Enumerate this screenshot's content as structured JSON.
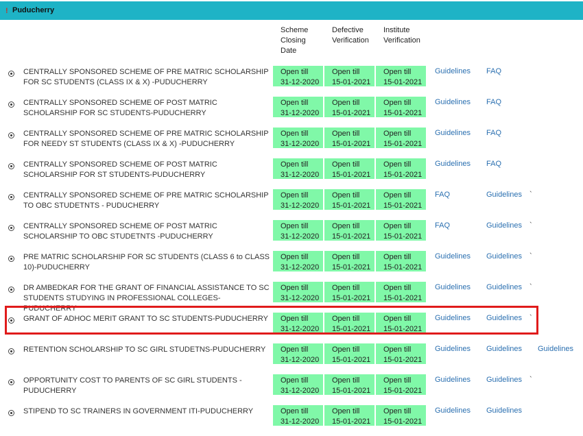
{
  "header": {
    "mark": "!",
    "title": "Puducherry"
  },
  "columns": {
    "closing": "Scheme Closing Date",
    "defective": "Defective Verification",
    "institute": "Institute Verification"
  },
  "rows": [
    {
      "name": "CENTRALLY SPONSORED SCHEME OF PRE MATRIC SCHOLARSHIP FOR SC STUDENTS (CLASS IX & X) -PUDUCHERRY",
      "closing": [
        "Open till",
        "31-12-2020"
      ],
      "defective": [
        "Open till",
        "15-01-2021"
      ],
      "institute": [
        "Open till",
        "15-01-2021"
      ],
      "links": [
        "Guidelines",
        "FAQ"
      ],
      "tick": ""
    },
    {
      "name": "CENTRALLY SPONSORED SCHEME OF POST MATRIC SCHOLARSHIP FOR SC STUDENTS-PUDUCHERRY",
      "closing": [
        "Open till",
        "31-12-2020"
      ],
      "defective": [
        "Open till",
        "15-01-2021"
      ],
      "institute": [
        "Open till",
        "15-01-2021"
      ],
      "links": [
        "Guidelines",
        "FAQ"
      ],
      "tick": ""
    },
    {
      "name": "CENTRALLY SPONSORED SCHEME OF PRE MATRIC SCHOLARSHIP FOR NEEDY ST STUDENTS (CLASS IX & X) -PUDUCHERRY",
      "closing": [
        "Open till",
        "31-12-2020"
      ],
      "defective": [
        "Open till",
        "15-01-2021"
      ],
      "institute": [
        "Open till",
        "15-01-2021"
      ],
      "links": [
        "Guidelines",
        "FAQ"
      ],
      "tick": ""
    },
    {
      "name": "CENTRALLY SPONSORED SCHEME OF POST MATRIC SCHOLARSHIP FOR ST STUDENTS-PUDUCHERRY",
      "closing": [
        "Open till",
        "31-12-2020"
      ],
      "defective": [
        "Open till",
        "15-01-2021"
      ],
      "institute": [
        "Open till",
        "15-01-2021"
      ],
      "links": [
        "Guidelines",
        "FAQ"
      ],
      "tick": ""
    },
    {
      "name": "CENTRALLY SPONSORED SCHEME OF PRE MATRIC SCHOLARSHIP TO OBC STUDETNTS - PUDUCHERRY",
      "closing": [
        "Open till",
        "31-12-2020"
      ],
      "defective": [
        "Open till",
        "15-01-2021"
      ],
      "institute": [
        "Open till",
        "15-01-2021"
      ],
      "links": [
        "FAQ",
        "Guidelines"
      ],
      "tick": "`"
    },
    {
      "name": "CENTRALLY SPONSORED SCHEME OF POST MATRIC SCHOLARSHIP TO OBC STUDETNTS -PUDUCHERRY",
      "closing": [
        "Open till",
        "31-12-2020"
      ],
      "defective": [
        "Open till",
        "15-01-2021"
      ],
      "institute": [
        "Open till",
        "15-01-2021"
      ],
      "links": [
        "FAQ",
        "Guidelines"
      ],
      "tick": "`"
    },
    {
      "name": "PRE MATRIC SCHOLARSHIP FOR SC STUDENTS (CLASS 6 to CLASS 10)-PUDUCHERRY",
      "closing": [
        "Open till",
        "31-12-2020"
      ],
      "defective": [
        "Open till",
        "15-01-2021"
      ],
      "institute": [
        "Open till",
        "15-01-2021"
      ],
      "links": [
        "Guidelines",
        "Guidelines"
      ],
      "tick": "`"
    },
    {
      "name": "DR AMBEDKAR FOR THE GRANT OF FINANCIAL ASSISTANCE TO SC STUDENTS STUDYING IN PROFESSIONAL COLLEGES-PUDUCHERRY",
      "closing": [
        "Open till",
        "31-12-2020"
      ],
      "defective": [
        "Open till",
        "15-01-2021"
      ],
      "institute": [
        "Open till",
        "15-01-2021"
      ],
      "links": [
        "Guidelines",
        "Guidelines"
      ],
      "tick": "`"
    },
    {
      "name": "GRANT OF ADHOC MERIT GRANT TO SC STUDENTS-PUDUCHERRY",
      "closing": [
        "Open till",
        "31-12-2020"
      ],
      "defective": [
        "Open till",
        "15-01-2021"
      ],
      "institute": [
        "Open till",
        "15-01-2021"
      ],
      "links": [
        "Guidelines",
        "Guidelines"
      ],
      "tick": "`"
    },
    {
      "name": "RETENTION SCHOLARSHIP TO SC GIRL STUDETNS-PUDUCHERRY",
      "closing": [
        "Open till",
        "31-12-2020"
      ],
      "defective": [
        "Open till",
        "15-01-2021"
      ],
      "institute": [
        "Open till",
        "15-01-2021"
      ],
      "links": [
        "Guidelines",
        "Guidelines",
        "Guidelines"
      ],
      "tick": ""
    },
    {
      "name": "OPPORTUNITY COST TO PARENTS OF SC GIRL STUDENTS -PUDUCHERRY",
      "closing": [
        "Open till",
        "31-12-2020"
      ],
      "defective": [
        "Open till",
        "15-01-2021"
      ],
      "institute": [
        "Open till",
        "15-01-2021"
      ],
      "links": [
        "Guidelines",
        "Guidelines"
      ],
      "tick": "`"
    },
    {
      "name": "STIPEND TO SC TRAINERS IN GOVERNMENT ITI-PUDUCHERRY",
      "closing": [
        "Open till",
        "31-12-2020"
      ],
      "defective": [
        "Open till",
        "15-01-2021"
      ],
      "institute": [
        "Open till",
        "15-01-2021"
      ],
      "links": [
        "Guidelines",
        "Guidelines"
      ],
      "tick": ""
    }
  ],
  "colors": {
    "header": "#1eb3c6",
    "cell": "#80f8a8",
    "link": "#2a6fb0",
    "highlight": "#e01b1b"
  }
}
